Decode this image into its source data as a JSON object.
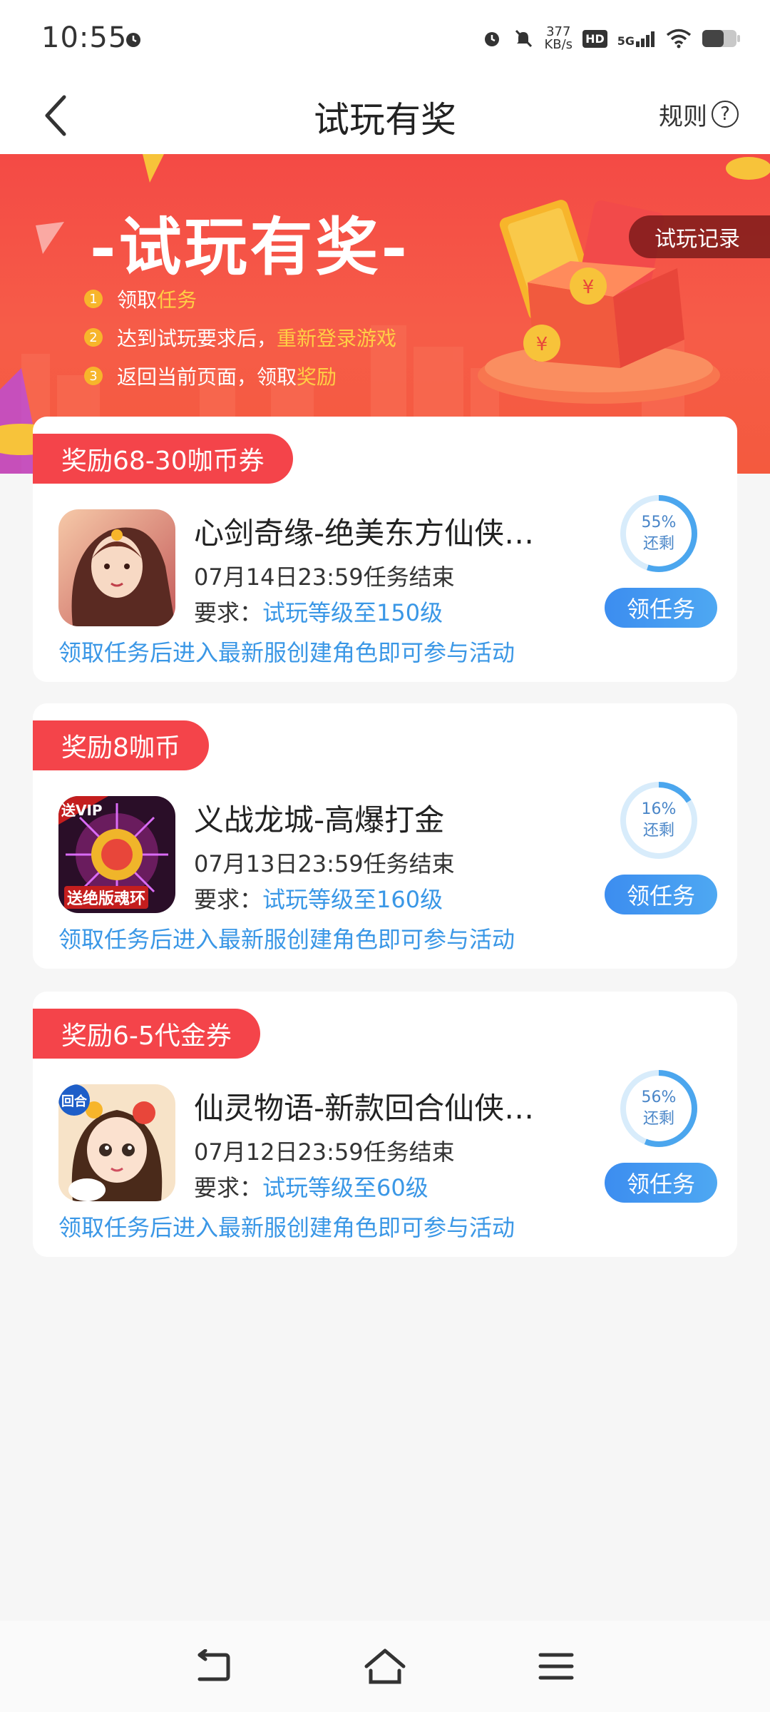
{
  "status_bar": {
    "time": "10:55",
    "net_speed_value": "377",
    "net_speed_unit": "KB/s",
    "hd_badge": "HD",
    "network": "5G",
    "icons": [
      "alarm-icon",
      "mute-icon",
      "signal-icon",
      "wifi-icon",
      "battery-icon"
    ]
  },
  "header": {
    "title": "试玩有奖",
    "rules_label": "规则",
    "help_glyph": "?"
  },
  "banner": {
    "title": "-试玩有奖-",
    "record_button": "试玩记录",
    "steps": [
      {
        "num": "1",
        "text": "领取",
        "highlight": "任务"
      },
      {
        "num": "2",
        "text": "达到试玩要求后，",
        "highlight": "重新登录游戏"
      },
      {
        "num": "3",
        "text": "返回当前页面，领取",
        "highlight": "奖励"
      }
    ]
  },
  "tasks": [
    {
      "reward": "奖励68-30咖币券",
      "name": "心剑奇缘-绝美东方仙侠…",
      "deadline": "07月14日23:59任务结束",
      "req_label": "要求：",
      "req_value": "试玩等级至150级",
      "note": "领取任务后进入最新服创建角色即可参与活动",
      "progress_percent": 55,
      "progress_label": "55%",
      "remaining_label": "还剩",
      "button": "领任务"
    },
    {
      "reward": "奖励8咖币",
      "name": "义战龙城-高爆打金",
      "deadline": "07月13日23:59任务结束",
      "req_label": "要求：",
      "req_value": "试玩等级至160级",
      "note": "领取任务后进入最新服创建角色即可参与活动",
      "progress_percent": 16,
      "progress_label": "16%",
      "remaining_label": "还剩",
      "button": "领任务",
      "icon_text_top": "送VIP",
      "icon_text_bottom": "送绝版魂环"
    },
    {
      "reward": "奖励6-5代金券",
      "name": "仙灵物语-新款回合仙侠…",
      "deadline": "07月12日23:59任务结束",
      "req_label": "要求：",
      "req_value": "试玩等级至60级",
      "note": "领取任务后进入最新服创建角色即可参与活动",
      "progress_percent": 56,
      "progress_label": "56%",
      "remaining_label": "还剩",
      "button": "领任务",
      "icon_text_top": "回合"
    }
  ],
  "nav": {
    "icons": [
      "back-nav-icon",
      "home-nav-icon",
      "menu-nav-icon"
    ]
  },
  "colors": {
    "accent_blue": "#3a97e6",
    "reward_red": "#f4444a",
    "banner_red": "#f44a45",
    "highlight_yellow": "#ffcf45"
  }
}
